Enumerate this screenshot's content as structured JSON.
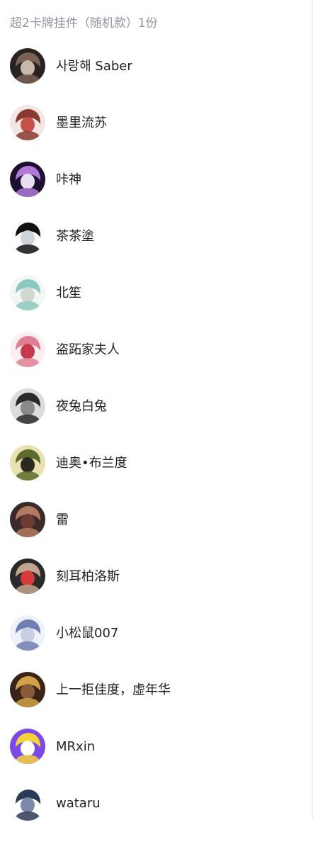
{
  "header": {
    "title": "超2卡牌挂件（随机款）1份"
  },
  "winners": [
    {
      "name": "사랑해 Saber",
      "avatar_icon": "saber-avatar-icon",
      "colors": [
        "#2b2222",
        "#7a6256",
        "#c7b8a8"
      ]
    },
    {
      "name": "墨里流苏",
      "avatar_icon": "anime-girl-red-avatar-icon",
      "colors": [
        "#f3e7e4",
        "#8a3a2e",
        "#c4514a"
      ]
    },
    {
      "name": "咔神",
      "avatar_icon": "purple-hair-avatar-icon",
      "colors": [
        "#1d1030",
        "#b07ad8",
        "#e8dff4"
      ]
    },
    {
      "name": "茶茶塗",
      "avatar_icon": "chibi-black-hair-avatar-icon",
      "colors": [
        "#ffffff",
        "#111111",
        "#cfd4da"
      ]
    },
    {
      "name": "北笙",
      "avatar_icon": "mint-hair-avatar-icon",
      "colors": [
        "#f3f7f2",
        "#8cc9c0",
        "#cfd9cf"
      ]
    },
    {
      "name": "盗跖家夫人",
      "avatar_icon": "pink-girl-avatar-icon",
      "colors": [
        "#fbeff2",
        "#e07f95",
        "#c43a4a"
      ]
    },
    {
      "name": "夜兔白兔",
      "avatar_icon": "monochrome-emblem-avatar-icon",
      "colors": [
        "#dcdcdc",
        "#2a2a2a",
        "#8a8a8a"
      ]
    },
    {
      "name": "迪奥•布兰度",
      "avatar_icon": "jojo-dio-avatar-icon",
      "colors": [
        "#e9e2b0",
        "#5d6b2a",
        "#2a2a22"
      ]
    },
    {
      "name": "雷",
      "avatar_icon": "dark-hair-boy-avatar-icon",
      "colors": [
        "#3b2a28",
        "#b37a62",
        "#6b3a30"
      ]
    },
    {
      "name": "刻耳柏洛斯",
      "avatar_icon": "dog-avatar-icon",
      "colors": [
        "#2a2a2a",
        "#c2a58f",
        "#d83a3a"
      ]
    },
    {
      "name": "小松鼠007",
      "avatar_icon": "white-hair-chibi-avatar-icon",
      "colors": [
        "#eef2fa",
        "#6f7fb5",
        "#c9cfe2"
      ]
    },
    {
      "name": "上一拒佳度，虚年华",
      "avatar_icon": "golden-warrior-avatar-icon",
      "colors": [
        "#3a2418",
        "#d2a24a",
        "#8a5a3a"
      ]
    },
    {
      "name": "MRxin",
      "avatar_icon": "yellow-purple-cartoon-avatar-icon",
      "colors": [
        "#7b49e6",
        "#f5d23a",
        "#ffffff"
      ]
    },
    {
      "name": "wataru",
      "avatar_icon": "fish-sketch-avatar-icon",
      "colors": [
        "#ffffff",
        "#2b3a55",
        "#7a8aa8"
      ]
    }
  ]
}
